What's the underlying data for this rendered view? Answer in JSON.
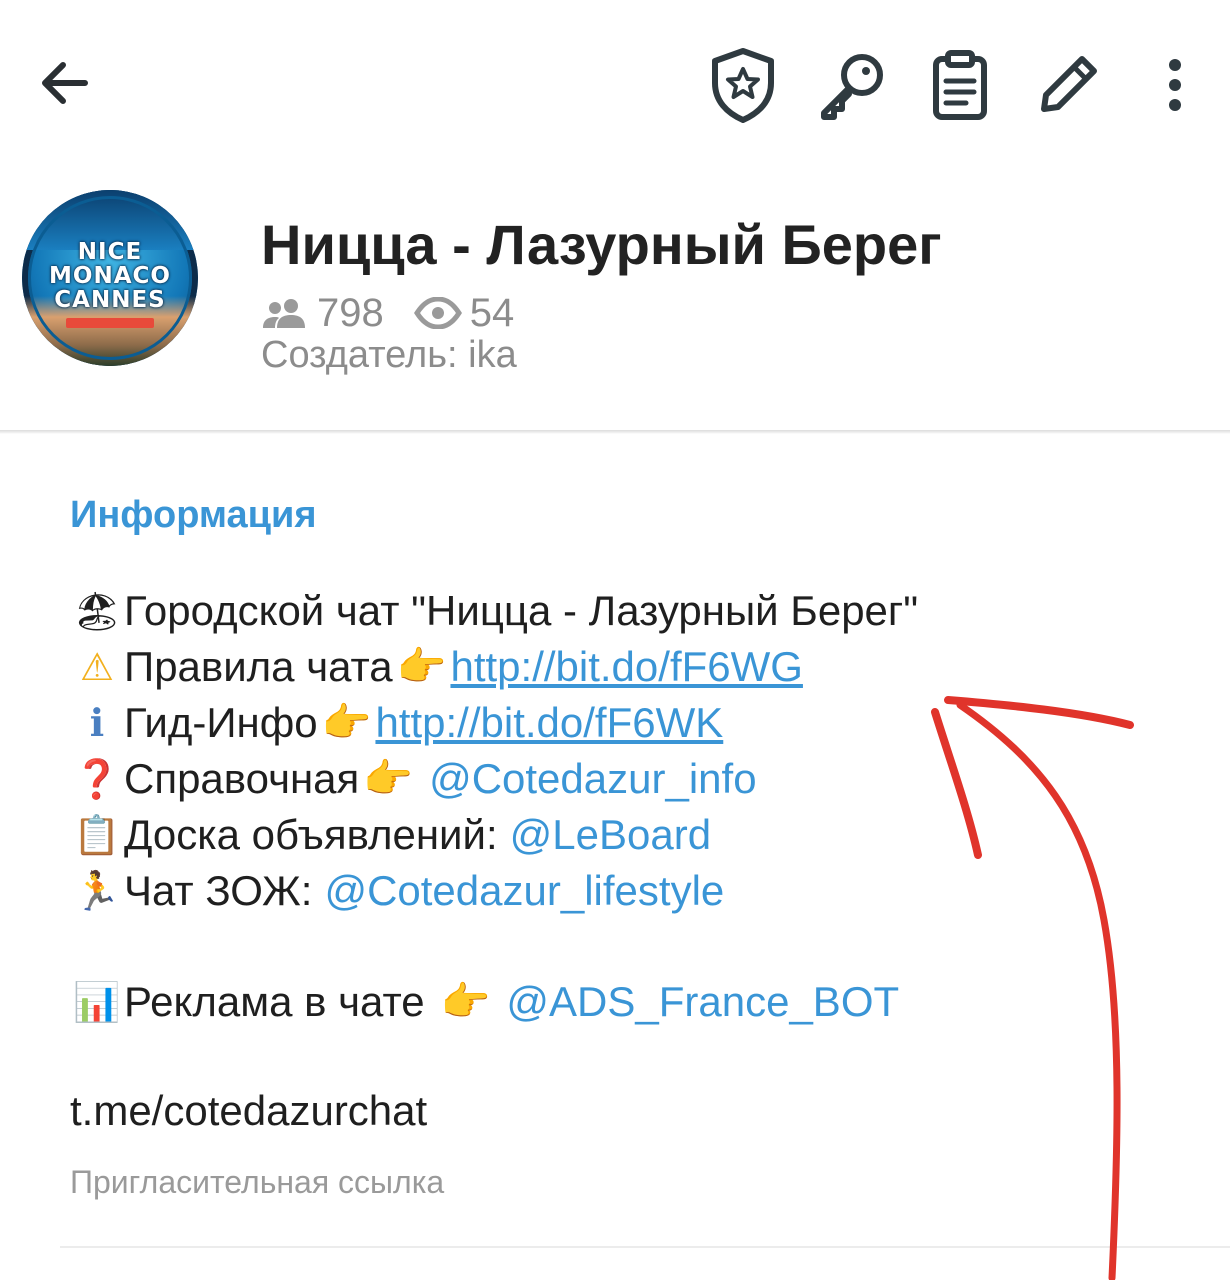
{
  "toolbar": {
    "icons": [
      "back-arrow-icon",
      "admin-shield-icon",
      "key-icon",
      "clipboard-log-icon",
      "pencil-icon",
      "more-vertical-icon"
    ]
  },
  "chat": {
    "title": "Ницца - Лазурный Берег",
    "members": "798",
    "online": "54",
    "creator": "Создатель: ika",
    "avatar_text": [
      "NICE",
      "MONACO",
      "CANNES"
    ]
  },
  "info": {
    "section_title": "Информация",
    "lines": [
      {
        "emoji": "🏖",
        "text": "Городской чат \"Ницца - Лазурный Берег\"",
        "pointer": "",
        "link": "",
        "link_type": ""
      },
      {
        "emoji": "⚠",
        "text": "Правила чата",
        "pointer": "👉",
        "link": "http://bit.do/fF6WG",
        "link_type": "url"
      },
      {
        "emoji": "ℹ",
        "text": "Гид-Инфо",
        "pointer": "👉",
        "link": "http://bit.do/fF6WK",
        "link_type": "url"
      },
      {
        "emoji": "❓",
        "text": "Справочная",
        "pointer": "👉",
        "link": "@Cotedazur_info",
        "link_type": "mention"
      },
      {
        "emoji": "📋",
        "text": "Доска объявлений:",
        "pointer": "",
        "link": "@LeBoard",
        "link_type": "mention"
      },
      {
        "emoji": "🏃",
        "text": "Чат ЗОЖ:",
        "pointer": "",
        "link": "@Cotedazur_lifestyle",
        "link_type": "mention"
      },
      {
        "emoji": "📊",
        "text": "Реклама в чате",
        "pointer": "👉",
        "link": "@ADS_France_BOT",
        "link_type": "mention"
      }
    ],
    "invite_link": "t.me/cotedazurchat",
    "invite_caption": "Пригласительная ссылка"
  },
  "colors": {
    "accent_blue": "#3a95d6",
    "annotation_red": "#e0342b",
    "secondary_text": "#8c8c8c"
  }
}
